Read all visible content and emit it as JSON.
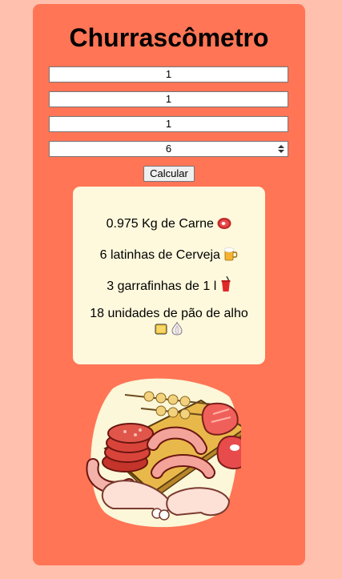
{
  "title": "Churrascômetro",
  "inputs": [
    {
      "value": "1"
    },
    {
      "value": "1"
    },
    {
      "value": "1"
    },
    {
      "value": "6"
    }
  ],
  "calculate_label": "Calcular",
  "results": {
    "meat": "0.975 Kg de Carne",
    "beer": "6 latinhas de Cerveja",
    "drink": "3 garrafinhas de 1 l",
    "bread_line1": "18 unidades de pão de alho"
  },
  "icons": {
    "meat": "meat-icon",
    "beer": "beer-mug-icon",
    "drink": "cup-with-straw-icon",
    "bread": "bread-icon",
    "garlic": "garlic-icon"
  },
  "colors": {
    "page_bg": "#ffc0ad",
    "card_bg": "#ff7556",
    "result_bg": "#fef9dd"
  }
}
